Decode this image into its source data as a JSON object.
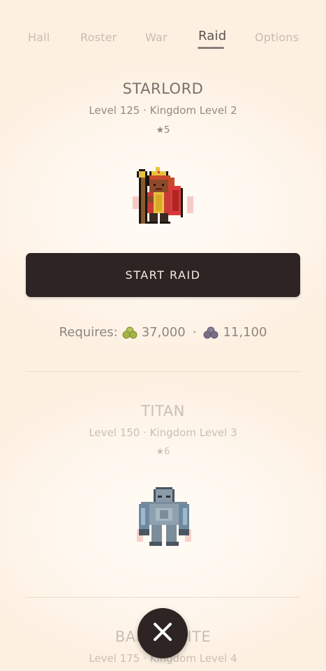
{
  "tabs": [
    {
      "label": "Hall"
    },
    {
      "label": "Roster"
    },
    {
      "label": "War"
    },
    {
      "label": "Raid"
    },
    {
      "label": "Options"
    }
  ],
  "active_tab": "Raid",
  "raids": [
    {
      "name": "STARLORD",
      "subtitle": "Level 125 · Kingdom Level 2",
      "stars": "★5",
      "sprite": "starlord-sprite",
      "start_label": "START RAID",
      "requires_label": "Requires:",
      "cost_green": "37,000",
      "separator": "·",
      "cost_purple": "11,100"
    },
    {
      "name": "TITAN",
      "subtitle": "Level 150 · Kingdom Level 3",
      "stars": "★6",
      "sprite": "titan-sprite"
    },
    {
      "name": "BALL SPRITE",
      "subtitle": "Level 175 · Kingdom Level 4"
    }
  ],
  "icons": {
    "close": "close-icon",
    "green_resource": "green-resource-icon",
    "purple_resource": "purple-resource-icon"
  },
  "colors": {
    "background": "#fdf0e1",
    "button_dark": "#2d2423",
    "text": "#7a716b"
  }
}
